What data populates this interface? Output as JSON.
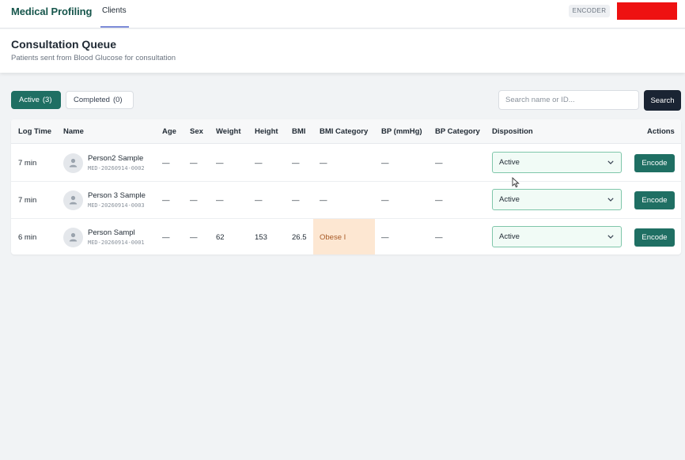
{
  "app": {
    "brand": "Medical Profiling",
    "nav_link": "Clients",
    "role_badge": "ENCODER"
  },
  "page": {
    "title": "Consultation Queue",
    "subtitle": "Patients sent from Blood Glucose for consultation"
  },
  "tabs": [
    {
      "label": "Active",
      "count": "(3)"
    },
    {
      "label": "Completed",
      "count": "(0)"
    }
  ],
  "search": {
    "placeholder": "Search name or ID...",
    "value": "",
    "button": "Search"
  },
  "table": {
    "headers": [
      "Log Time",
      "Name",
      "Age",
      "Sex",
      "Weight",
      "Height",
      "BMI",
      "BMI Category",
      "BP (mmHg)",
      "BP Category",
      "Disposition",
      "Actions"
    ],
    "rows": [
      {
        "log_time": "7 min",
        "name": "Person2 Sample",
        "id": "MED-20260914-0002",
        "age": "—",
        "sex": "—",
        "weight": "—",
        "height": "—",
        "bmi": "—",
        "bmi_category": "—",
        "bp": "—",
        "bp_category": "—",
        "disposition": "Active",
        "action": "Encode"
      },
      {
        "log_time": "7 min",
        "name": "Person 3 Sample",
        "id": "MED-20260914-0003",
        "age": "—",
        "sex": "—",
        "weight": "—",
        "height": "—",
        "bmi": "—",
        "bmi_category": "—",
        "bp": "—",
        "bp_category": "—",
        "disposition": "Active",
        "action": "Encode"
      },
      {
        "log_time": "6 min",
        "name": "Person Sampl",
        "id": "MED-20260914-0001",
        "age": "—",
        "sex": "—",
        "weight": "62",
        "height": "153",
        "bmi": "26.5",
        "bmi_category": "Obese I",
        "bp": "—",
        "bp_category": "—",
        "disposition": "Active",
        "action": "Encode"
      }
    ]
  },
  "colors": {
    "primary": "#1f6f63",
    "dark_button": "#1a2433",
    "bmi_highlight": "#fde7d2",
    "disposition_border": "#7fc6aa"
  }
}
